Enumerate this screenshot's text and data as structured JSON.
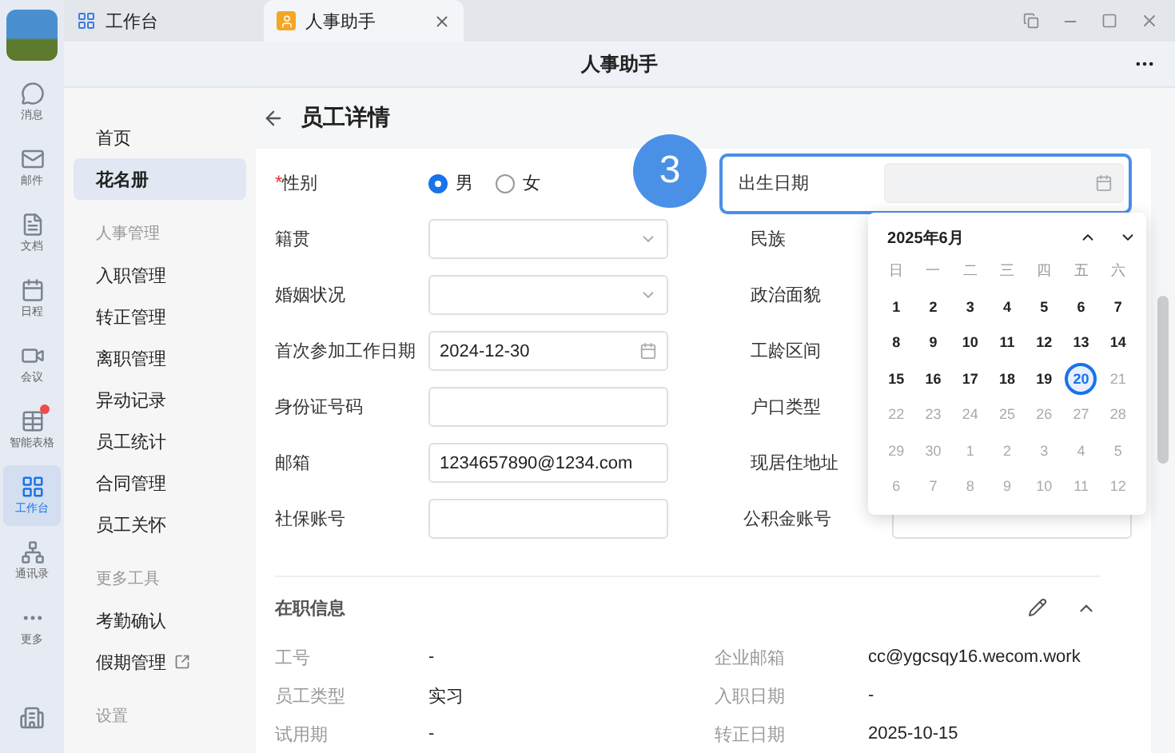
{
  "tabs": [
    {
      "label": "工作台",
      "selected": false,
      "closable": false
    },
    {
      "label": "人事助手",
      "selected": true,
      "closable": true
    }
  ],
  "header": {
    "title": "人事助手"
  },
  "rail": {
    "items": [
      {
        "label": "消息",
        "selected": false,
        "dot": false
      },
      {
        "label": "邮件",
        "selected": false,
        "dot": false
      },
      {
        "label": "文档",
        "selected": false,
        "dot": false
      },
      {
        "label": "日程",
        "selected": false,
        "dot": false
      },
      {
        "label": "会议",
        "selected": false,
        "dot": false
      },
      {
        "label": "智能表格",
        "selected": false,
        "dot": true
      },
      {
        "label": "工作台",
        "selected": true,
        "dot": false
      },
      {
        "label": "通讯录",
        "selected": false,
        "dot": false
      },
      {
        "label": "更多",
        "selected": false,
        "dot": false
      }
    ]
  },
  "nav": {
    "items": [
      {
        "kind": "link",
        "label": "首页",
        "selected": false,
        "external": false
      },
      {
        "kind": "link",
        "label": "花名册",
        "selected": true,
        "external": false
      },
      {
        "kind": "section",
        "label": "人事管理"
      },
      {
        "kind": "link",
        "label": "入职管理",
        "selected": false,
        "external": false
      },
      {
        "kind": "link",
        "label": "转正管理",
        "selected": false,
        "external": false
      },
      {
        "kind": "link",
        "label": "离职管理",
        "selected": false,
        "external": false
      },
      {
        "kind": "link",
        "label": "异动记录",
        "selected": false,
        "external": false
      },
      {
        "kind": "link",
        "label": "员工统计",
        "selected": false,
        "external": false
      },
      {
        "kind": "link",
        "label": "合同管理",
        "selected": false,
        "external": false
      },
      {
        "kind": "link",
        "label": "员工关怀",
        "selected": false,
        "external": false
      },
      {
        "kind": "section",
        "label": "更多工具"
      },
      {
        "kind": "link",
        "label": "考勤确认",
        "selected": false,
        "external": false
      },
      {
        "kind": "link",
        "label": "假期管理",
        "selected": false,
        "external": true
      },
      {
        "kind": "section",
        "label": "设置"
      }
    ]
  },
  "page": {
    "title": "员工详情"
  },
  "form": {
    "rows": [
      {
        "left": {
          "label": "性别",
          "required_mark": "*",
          "kind": "radio",
          "options": [
            {
              "label": "男",
              "selected": true
            },
            {
              "label": "女",
              "selected": false
            }
          ]
        },
        "right": {
          "label": "出生日期",
          "kind": "date",
          "highlighted": true,
          "step": "3"
        }
      },
      {
        "left": {
          "label": "籍贯",
          "kind": "select"
        },
        "right": {
          "label": "民族",
          "kind": "covered"
        }
      },
      {
        "left": {
          "label": "婚姻状况",
          "kind": "select"
        },
        "right": {
          "label": "政治面貌",
          "kind": "covered"
        }
      },
      {
        "left": {
          "label": "首次参加工作日期",
          "kind": "date",
          "value": "2024-12-30"
        },
        "right": {
          "label": "工龄区间",
          "kind": "covered"
        }
      },
      {
        "left": {
          "label": "身份证号码",
          "kind": "text"
        },
        "right": {
          "label": "户口类型",
          "kind": "covered"
        }
      },
      {
        "left": {
          "label": "邮箱",
          "kind": "text",
          "value": "1234657890@1234.com"
        },
        "right": {
          "label": "现居住地址",
          "kind": "covered"
        }
      },
      {
        "left": {
          "label": "社保账号",
          "kind": "text"
        },
        "right": {
          "label": "公积金账号",
          "kind": "text"
        }
      }
    ]
  },
  "calendar": {
    "title": "2025年6月",
    "weekdays": [
      "日",
      "一",
      "二",
      "三",
      "四",
      "五",
      "六"
    ],
    "weeks": [
      [
        {
          "day": "1",
          "muted": false,
          "selected": false
        },
        {
          "day": "2",
          "muted": false,
          "selected": false
        },
        {
          "day": "3",
          "muted": false,
          "selected": false
        },
        {
          "day": "4",
          "muted": false,
          "selected": false
        },
        {
          "day": "5",
          "muted": false,
          "selected": false
        },
        {
          "day": "6",
          "muted": false,
          "selected": false
        },
        {
          "day": "7",
          "muted": false,
          "selected": false
        }
      ],
      [
        {
          "day": "8",
          "muted": false,
          "selected": false
        },
        {
          "day": "9",
          "muted": false,
          "selected": false
        },
        {
          "day": "10",
          "muted": false,
          "selected": false
        },
        {
          "day": "11",
          "muted": false,
          "selected": false
        },
        {
          "day": "12",
          "muted": false,
          "selected": false
        },
        {
          "day": "13",
          "muted": false,
          "selected": false
        },
        {
          "day": "14",
          "muted": false,
          "selected": false
        }
      ],
      [
        {
          "day": "15",
          "muted": false,
          "selected": false
        },
        {
          "day": "16",
          "muted": false,
          "selected": false
        },
        {
          "day": "17",
          "muted": false,
          "selected": false
        },
        {
          "day": "18",
          "muted": false,
          "selected": false
        },
        {
          "day": "19",
          "muted": false,
          "selected": false
        },
        {
          "day": "20",
          "muted": false,
          "selected": true
        },
        {
          "day": "21",
          "muted": true,
          "selected": false
        }
      ],
      [
        {
          "day": "22",
          "muted": true,
          "selected": false
        },
        {
          "day": "23",
          "muted": true,
          "selected": false
        },
        {
          "day": "24",
          "muted": true,
          "selected": false
        },
        {
          "day": "25",
          "muted": true,
          "selected": false
        },
        {
          "day": "26",
          "muted": true,
          "selected": false
        },
        {
          "day": "27",
          "muted": true,
          "selected": false
        },
        {
          "day": "28",
          "muted": true,
          "selected": false
        }
      ],
      [
        {
          "day": "29",
          "muted": true,
          "selected": false
        },
        {
          "day": "30",
          "muted": true,
          "selected": false
        },
        {
          "day": "1",
          "muted": true,
          "selected": false
        },
        {
          "day": "2",
          "muted": true,
          "selected": false
        },
        {
          "day": "3",
          "muted": true,
          "selected": false
        },
        {
          "day": "4",
          "muted": true,
          "selected": false
        },
        {
          "day": "5",
          "muted": true,
          "selected": false
        }
      ],
      [
        {
          "day": "6",
          "muted": true,
          "selected": false
        },
        {
          "day": "7",
          "muted": true,
          "selected": false
        },
        {
          "day": "8",
          "muted": true,
          "selected": false
        },
        {
          "day": "9",
          "muted": true,
          "selected": false
        },
        {
          "day": "10",
          "muted": true,
          "selected": false
        },
        {
          "day": "11",
          "muted": true,
          "selected": false
        },
        {
          "day": "12",
          "muted": true,
          "selected": false
        }
      ]
    ]
  },
  "section": {
    "title": "在职信息",
    "expanded": true,
    "rows": [
      [
        {
          "label": "工号",
          "value": "-"
        },
        {
          "label": "企业邮箱",
          "value": "cc@ygcsqy16.wecom.work"
        }
      ],
      [
        {
          "label": "员工类型",
          "value": "实习"
        },
        {
          "label": "入职日期",
          "value": "-"
        }
      ],
      [
        {
          "label": "试用期",
          "value": "-"
        },
        {
          "label": "转正日期",
          "value": "2025-10-15"
        }
      ]
    ]
  }
}
